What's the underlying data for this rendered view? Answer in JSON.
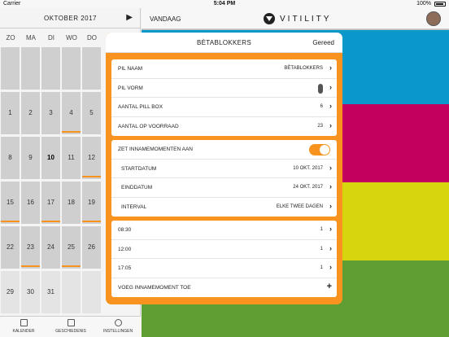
{
  "status": {
    "carrier": "Carrier",
    "time": "5:04 PM",
    "battery": "100%"
  },
  "calendar": {
    "month": "OKTOBER 2017",
    "weekdays": [
      "ZO",
      "MA",
      "DI",
      "WO",
      "DO"
    ],
    "rows": [
      [
        {
          "d": "",
          "light": false,
          "mark": false
        },
        {
          "d": "",
          "light": false,
          "mark": false
        },
        {
          "d": "",
          "light": false,
          "mark": false
        },
        {
          "d": "",
          "light": false,
          "mark": false
        },
        {
          "d": "",
          "light": false,
          "mark": false
        }
      ],
      [
        {
          "d": "1",
          "light": false,
          "mark": false
        },
        {
          "d": "2",
          "light": false,
          "mark": false
        },
        {
          "d": "3",
          "light": false,
          "mark": false
        },
        {
          "d": "4",
          "light": false,
          "mark": true
        },
        {
          "d": "5",
          "light": false,
          "mark": false
        }
      ],
      [
        {
          "d": "8",
          "light": false,
          "mark": false
        },
        {
          "d": "9",
          "light": false,
          "mark": false
        },
        {
          "d": "10",
          "light": false,
          "mark": false,
          "today": true
        },
        {
          "d": "11",
          "light": false,
          "mark": false
        },
        {
          "d": "12",
          "light": false,
          "mark": true
        }
      ],
      [
        {
          "d": "15",
          "light": false,
          "mark": true
        },
        {
          "d": "16",
          "light": false,
          "mark": false
        },
        {
          "d": "17",
          "light": false,
          "mark": true
        },
        {
          "d": "18",
          "light": false,
          "mark": false
        },
        {
          "d": "19",
          "light": false,
          "mark": true
        }
      ],
      [
        {
          "d": "22",
          "light": false,
          "mark": false
        },
        {
          "d": "23",
          "light": false,
          "mark": true
        },
        {
          "d": "24",
          "light": false,
          "mark": false
        },
        {
          "d": "25",
          "light": false,
          "mark": true
        },
        {
          "d": "26",
          "light": false,
          "mark": false
        }
      ],
      [
        {
          "d": "29",
          "light": true,
          "mark": false
        },
        {
          "d": "30",
          "light": true,
          "mark": false
        },
        {
          "d": "31",
          "light": true,
          "mark": false
        },
        {
          "d": "",
          "light": true,
          "mark": false
        },
        {
          "d": "",
          "light": true,
          "mark": false
        }
      ]
    ]
  },
  "tabs": [
    {
      "label": "KALENDER"
    },
    {
      "label": "GESCHIEDENIS"
    },
    {
      "label": "INSTELLINGEN"
    }
  ],
  "header": {
    "today": "VANDAAG",
    "brand": "VITILITY"
  },
  "bands": [
    "#0a97c9",
    "#c4005f",
    "#d7d60e",
    "#5f9e32"
  ],
  "colors": {
    "accent": "#f7931e"
  },
  "modal": {
    "title": "BÈTABLOKKERS",
    "done": "Gereed",
    "group1": [
      {
        "label": "PIL NAAM",
        "value": "BÈTABLOKKERS"
      },
      {
        "label": "PIL VORM",
        "value": ""
      },
      {
        "label": "AANTAL PILL BOX",
        "value": "6"
      },
      {
        "label": "AANTAL OP VOORRAAD",
        "value": "23"
      }
    ],
    "group2": {
      "toggle_label": "ZET INNAMEMOMENTEN AAN",
      "toggle_on": true,
      "rows": [
        {
          "label": "STARTDATUM",
          "value": "10 OKT. 2017"
        },
        {
          "label": "EINDDATUM",
          "value": "24 OKT. 2017"
        },
        {
          "label": "INTERVAL",
          "value": "ELKE TWEE DAGEN"
        }
      ]
    },
    "group3": [
      {
        "label": "08:30",
        "value": "1"
      },
      {
        "label": "12:00",
        "value": "1"
      },
      {
        "label": "17:05",
        "value": "1"
      }
    ],
    "add_label": "VOEG INNAMEMOMENT TOE"
  }
}
